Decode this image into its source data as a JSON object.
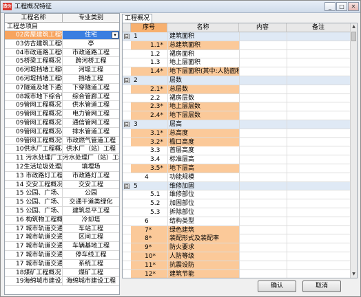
{
  "window": {
    "title": "工程概况特征",
    "icon_label": "造价"
  },
  "left_panel": {
    "col1_header": "工程名称",
    "col2_header": "专业类别",
    "group_label": "工程总项目",
    "rows": [
      {
        "name": "02房屋建筑工程概",
        "category": "住宅"
      },
      {
        "name": "03仿古建筑工程概",
        "category": "亭"
      },
      {
        "name": "04市政道路工程概",
        "category": "市政道路工程"
      },
      {
        "name": "05桥梁工程概况",
        "category": "跨河桥工程"
      },
      {
        "name": "06河堤挡墙工程概",
        "category": "河堤工程"
      },
      {
        "name": "06河堤挡墙工程概",
        "category": "挡墙工程"
      },
      {
        "name": "07隧道及地下通道",
        "category": "下穿隧道工程"
      },
      {
        "name": "08城市地下综合管",
        "category": "综合管廊工程"
      },
      {
        "name": "09管网工程概况1",
        "category": "供水管道工程"
      },
      {
        "name": "09管网工程概况2",
        "category": "电力管网工程"
      },
      {
        "name": "09管网工程概况3",
        "category": "通信管网工程"
      },
      {
        "name": "09管网工程概况4",
        "category": "排水管道工程"
      },
      {
        "name": "09管网工程概况5",
        "category": "市政燃气管道工程"
      },
      {
        "name": "10供水厂工程概况",
        "category": "供水厂（站）工程"
      },
      {
        "name": "11 污水处理厂工程",
        "category": "污水处理厂（站）工程"
      },
      {
        "name": "12生活垃圾处理厂",
        "category": "填埋场"
      },
      {
        "name": "13 市政路灯工程概",
        "category": "市政路灯工程"
      },
      {
        "name": "14 交安工程概况",
        "category": "交安工程"
      },
      {
        "name": "15 公园、广场、交",
        "category": "公园"
      },
      {
        "name": "15 公园、广场、交",
        "category": "交通干道类绿化"
      },
      {
        "name": "15 公园、广场、交",
        "category": "建筑总平工程"
      },
      {
        "name": "16 构筑物工程概况",
        "category": "冷却塔"
      },
      {
        "name": "17 城市轨道交通工",
        "category": "车站工程"
      },
      {
        "name": "17 城市轨道交通工",
        "category": "区间工程"
      },
      {
        "name": "17 城市轨道交通工",
        "category": "车辆基地工程"
      },
      {
        "name": "17 城市轨道交通工",
        "category": "停车线工程"
      },
      {
        "name": "17 城市轨道交通工",
        "category": "系统工程"
      },
      {
        "name": "18煤矿工程概况",
        "category": "煤矿工程"
      },
      {
        "name": "19海绵城市建设工",
        "category": "海绵城市建设工程"
      }
    ],
    "dropdown_glyph": "▾"
  },
  "tab_label": "工程概况",
  "grid": {
    "headers": {
      "no": "序号",
      "name": "名称",
      "content": "内容",
      "remark": "备注"
    },
    "rows": [
      {
        "tog": "⊟",
        "no": "1",
        "name": "建筑面积",
        "lvl": "l1"
      },
      {
        "tog": "",
        "no": "1.1*",
        "name": "总建筑面积",
        "lvl": "l2 alt"
      },
      {
        "tog": "",
        "no": "1.2",
        "name": "裙房面积",
        "lvl": "l2"
      },
      {
        "tog": "",
        "no": "1.3",
        "name": "地上层面积",
        "lvl": "l2"
      },
      {
        "tog": "",
        "no": "1.4*",
        "name": "地下层面积(其中:人防面积)",
        "lvl": "l2 alt"
      },
      {
        "tog": "⊟",
        "no": "2",
        "name": "层数",
        "lvl": "l1"
      },
      {
        "tog": "",
        "no": "2.1*",
        "name": "总层数",
        "lvl": "l2 alt"
      },
      {
        "tog": "",
        "no": "2.2",
        "name": "裙房层数",
        "lvl": "l2"
      },
      {
        "tog": "",
        "no": "2.3*",
        "name": "地上层层数",
        "lvl": "l2 alt"
      },
      {
        "tog": "",
        "no": "2.4*",
        "name": "地下层层数",
        "lvl": "l2 alt"
      },
      {
        "tog": "⊟",
        "no": "3",
        "name": "层高",
        "lvl": "l1"
      },
      {
        "tog": "",
        "no": "3.1*",
        "name": "总高度",
        "lvl": "l2 alt"
      },
      {
        "tog": "",
        "no": "3.2*",
        "name": "檐口高度",
        "lvl": "l2 alt"
      },
      {
        "tog": "",
        "no": "3.3",
        "name": "首层高度",
        "lvl": "l2"
      },
      {
        "tog": "",
        "no": "3.4",
        "name": "标准层高",
        "lvl": "l2"
      },
      {
        "tog": "",
        "no": "3.5*",
        "name": "地下层高",
        "lvl": "l2 alt"
      },
      {
        "tog": "",
        "no": "4",
        "name": "功能规模",
        "lvl": "l1p"
      },
      {
        "tog": "⊟",
        "no": "5",
        "name": "维修加固",
        "lvl": "l1"
      },
      {
        "tog": "",
        "no": "5.1",
        "name": "维修部位",
        "lvl": "l2"
      },
      {
        "tog": "",
        "no": "5.2",
        "name": "加固部位",
        "lvl": "l2"
      },
      {
        "tog": "",
        "no": "5.3",
        "name": "拆除部位",
        "lvl": "l2"
      },
      {
        "tog": "",
        "no": "6",
        "name": "结构类型",
        "lvl": "l1p"
      },
      {
        "tog": "",
        "no": "7*",
        "name": "绿色建筑",
        "lvl": "l1s"
      },
      {
        "tog": "",
        "no": "8*",
        "name": "装配形式及装配率",
        "lvl": "l1s"
      },
      {
        "tog": "",
        "no": "9*",
        "name": "防火要求",
        "lvl": "l1s"
      },
      {
        "tog": "",
        "no": "10*",
        "name": "人防等级",
        "lvl": "l1s"
      },
      {
        "tog": "",
        "no": "11*",
        "name": "抗震设防",
        "lvl": "l1s"
      },
      {
        "tog": "",
        "no": "12*",
        "name": "建筑节能",
        "lvl": "l1s"
      },
      {
        "tog": "⊞",
        "no": "13",
        "name": "建材要求",
        "lvl": "l1"
      }
    ]
  },
  "buttons": {
    "ok": "确认",
    "cancel": "取消"
  },
  "titlebar_buttons": {
    "minimize": "_",
    "maximize": "□",
    "close": "✕"
  },
  "scroll": {
    "up": "▲",
    "down": "▼"
  }
}
